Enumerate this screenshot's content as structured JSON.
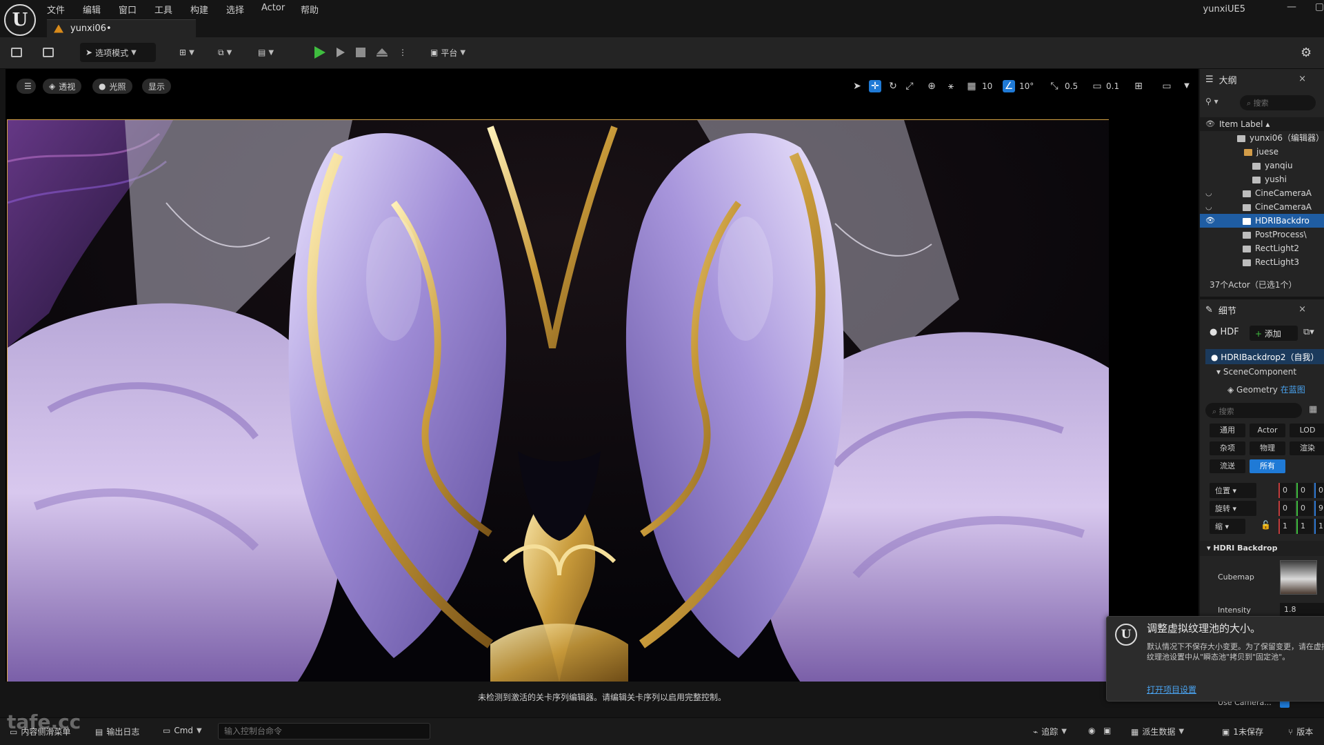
{
  "menu": [
    "文件",
    "编辑",
    "窗口",
    "工具",
    "构建",
    "选择",
    "Actor",
    "帮助"
  ],
  "window_title": "yunxiUE5",
  "document_tab": "yunxi06•",
  "toolbar": {
    "mode_label": "选项模式",
    "platform_label": "平台"
  },
  "viewport": {
    "menu_icon": "hamburger-icon",
    "perspective": "透视",
    "lighting": "光照",
    "show": "显示",
    "grid_snap": "10",
    "rotation_snap": "10°",
    "scale_snap": "0.5",
    "camera_speed": "0.1",
    "sequencer_message": "未检测到激活的关卡序列编辑器。请编辑关卡序列以启用完整控制。"
  },
  "outliner": {
    "title": "大纲",
    "search_placeholder": "搜索",
    "column_label": "Item Label ▴",
    "items": [
      {
        "label": "yunxi06（编辑器）",
        "type": "level"
      },
      {
        "label": "juese",
        "type": "folder"
      },
      {
        "label": "yanqiu",
        "type": "mesh"
      },
      {
        "label": "yushi",
        "type": "mesh"
      },
      {
        "label": "CineCameraA",
        "type": "camera"
      },
      {
        "label": "CineCameraA",
        "type": "camera"
      },
      {
        "label": "HDRIBackdro",
        "type": "actor",
        "selected": true
      },
      {
        "label": "PostProcess\\",
        "type": "volume"
      },
      {
        "label": "RectLight2",
        "type": "light"
      },
      {
        "label": "RectLight3",
        "type": "light"
      }
    ],
    "footer": "37个Actor（已选1个）"
  },
  "details": {
    "title": "细节",
    "actor_short": "HDF",
    "add_label": "添加",
    "root_component": "HDRIBackdrop2（自我）",
    "scene_component": "SceneComponent",
    "geometry": "Geometry",
    "geometry_link": "在蓝图",
    "search_placeholder": "搜索",
    "categories": [
      "通用",
      "Actor",
      "LOD",
      "杂项",
      "物理",
      "渲染",
      "流送",
      "所有"
    ],
    "transform": [
      {
        "label": "位置",
        "values": [
          "0",
          "0",
          "0"
        ]
      },
      {
        "label": "旋转",
        "values": [
          "0",
          "0",
          "9"
        ]
      },
      {
        "label": "缩",
        "values": [
          "1",
          "1",
          "1"
        ]
      }
    ],
    "section": "HDRI Backdrop",
    "cubemap_label": "Cubemap",
    "intensity_label": "Intensity",
    "intensity_value": "1.8",
    "use_camera_label": "Use Camera..."
  },
  "statusbar": {
    "content_drawer": "内容侧滑菜单",
    "output_log": "输出日志",
    "cmd": "Cmd",
    "cmd_placeholder": "输入控制台命令",
    "trace": "追踪",
    "source_data": "派生数据",
    "unsaved": "1未保存",
    "version": "版本"
  },
  "notification": {
    "title": "调整虚拟纹理池的大小。",
    "body": "默认情况下不保存大小变更。为了保留变更，请在虚拟纹理池设置中从\"瞬态池\"拷贝到\"固定池\"。",
    "link": "打开项目设置"
  },
  "watermark": "tafe.cc",
  "colors": {
    "accent": "#1f7ad6",
    "play_green": "#3fbd3f",
    "viewport_border": "#d6a445"
  }
}
